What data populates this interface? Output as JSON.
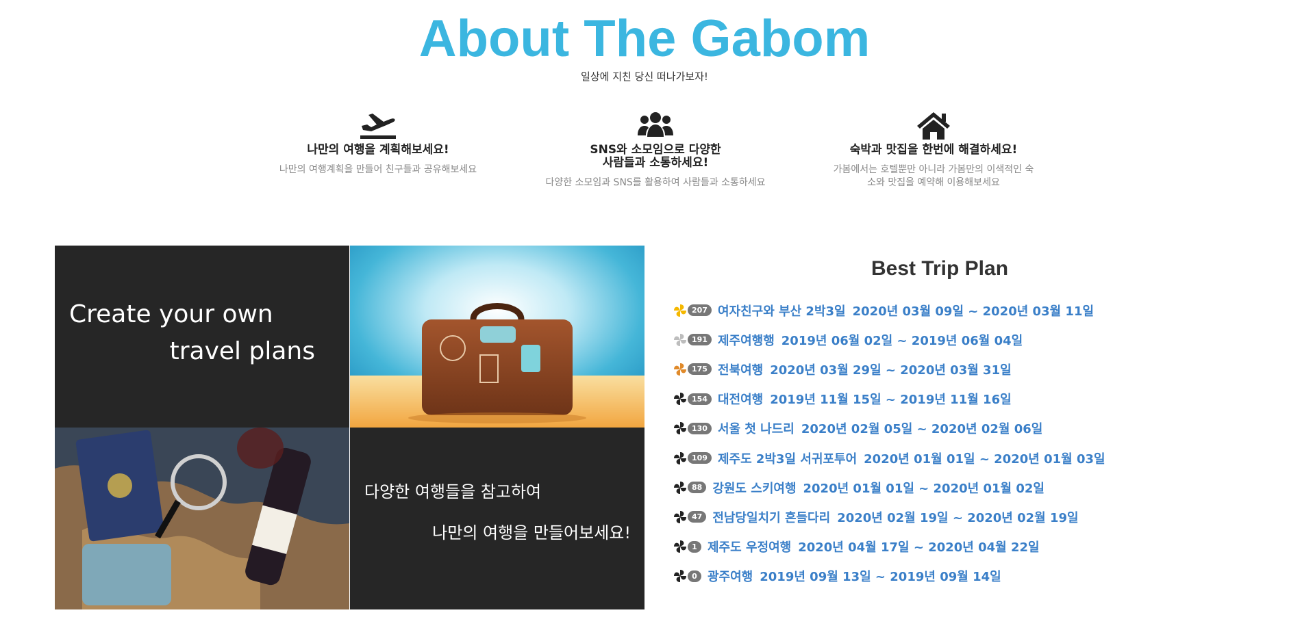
{
  "header": {
    "title": "About The Gabom",
    "subtitle": "일상에 지친 당신 떠나가보자!"
  },
  "features": [
    {
      "icon": "airplane-departure-icon",
      "title": "나만의 여행을 계획해보세요!",
      "description": "나만의 여행계획을 만들어 친구들과 공유해보세요"
    },
    {
      "icon": "users-group-icon",
      "title_line1": "SNS와 소모임으로 다양한",
      "title_line2": "사람들과 소통하세요!",
      "description": "다양한 소모임과 SNS를 활용하여 사람들과 소통하세요"
    },
    {
      "icon": "home-icon",
      "title": "숙박과 맛집을 한번에 해결하세요!",
      "description": "가봄에서는 호텔뿐만 아니라 가봄만의 이색적인 숙소와 맛집을 예약해 이용해보세요"
    }
  ],
  "promo": {
    "create_line1": "Create your own",
    "create_line2": "travel plans",
    "ref_line1": "다양한 여행들을 참고하여",
    "ref_line2": "나만의 여행을 만들어보세요!"
  },
  "best_trip": {
    "title": "Best Trip Plan",
    "plans": [
      {
        "count": "207",
        "name": "여자친구와 부산 2박3일",
        "dates": "2020년 03월 09일 ~ 2020년 03월 11일",
        "medal": "gold"
      },
      {
        "count": "191",
        "name": "제주여행행",
        "dates": "2019년 06월 02일 ~ 2019년 06월 04일",
        "medal": "silver"
      },
      {
        "count": "175",
        "name": "전북여행",
        "dates": "2020년 03월 29일 ~ 2020년 03월 31일",
        "medal": "bronze"
      },
      {
        "count": "154",
        "name": "대전여행",
        "dates": "2019년 11월 15일 ~ 2019년 11월 16일",
        "medal": "black"
      },
      {
        "count": "130",
        "name": "서울 첫 나드리",
        "dates": "2020년 02월 05일 ~ 2020년 02월 06일",
        "medal": "black"
      },
      {
        "count": "109",
        "name": "제주도 2박3일 서귀포투어",
        "dates": "2020년 01월 01일 ~ 2020년 01월 03일",
        "medal": "black"
      },
      {
        "count": "88",
        "name": "강원도 스키여행",
        "dates": "2020년 01월 01일 ~ 2020년 01월 02일",
        "medal": "black"
      },
      {
        "count": "47",
        "name": "전남당일치기 흔들다리",
        "dates": "2020년 02월 19일 ~ 2020년 02월 19일",
        "medal": "black"
      },
      {
        "count": "1",
        "name": "제주도 우정여행",
        "dates": "2020년 04월 17일 ~ 2020년 04월 22일",
        "medal": "black"
      },
      {
        "count": "0",
        "name": "광주여행",
        "dates": "2019년 09월 13일 ~ 2019년 09월 14일",
        "medal": "black"
      }
    ]
  },
  "colors": {
    "title_blue": "#3bb6e0",
    "link_blue": "#3a7fc8",
    "tile_dark": "#262626",
    "gold": "#f5b800",
    "silver": "#bdbdbd",
    "bronze": "#e08a2a",
    "black": "#222222"
  }
}
